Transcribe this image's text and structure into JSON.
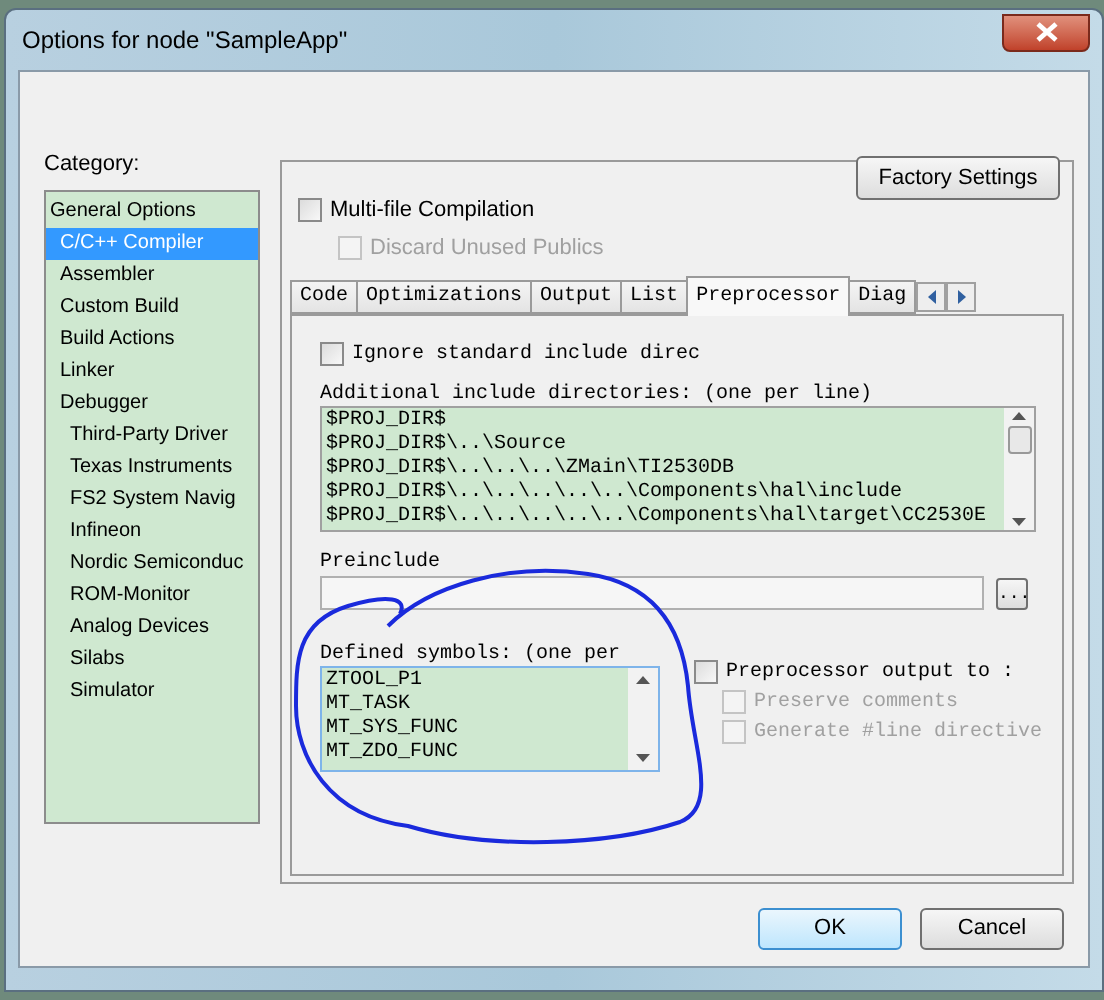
{
  "window": {
    "title": "Options for node \"SampleApp\""
  },
  "category_label": "Category:",
  "categories": [
    {
      "label": "General Options",
      "selected": false,
      "children": [
        {
          "label": "C/C++ Compiler",
          "selected": true
        },
        {
          "label": "Assembler",
          "selected": false
        },
        {
          "label": "Custom Build",
          "selected": false
        },
        {
          "label": "Build Actions",
          "selected": false
        },
        {
          "label": "Linker",
          "selected": false
        },
        {
          "label": "Debugger",
          "selected": false,
          "children": [
            {
              "label": "Third-Party Driver",
              "selected": false
            },
            {
              "label": "Texas Instruments",
              "selected": false
            },
            {
              "label": "FS2 System Navig",
              "selected": false
            },
            {
              "label": "Infineon",
              "selected": false
            },
            {
              "label": "Nordic Semiconduc",
              "selected": false
            },
            {
              "label": "ROM-Monitor",
              "selected": false
            },
            {
              "label": "Analog Devices",
              "selected": false
            },
            {
              "label": "Silabs",
              "selected": false
            },
            {
              "label": "Simulator",
              "selected": false
            }
          ]
        }
      ]
    }
  ],
  "factory_settings_button": "Factory Settings",
  "options": [
    {
      "label": "Multi-file Compilation",
      "checked": false,
      "disabled": false,
      "indent": false
    },
    {
      "label": "Discard Unused Publics",
      "checked": false,
      "disabled": true,
      "indent": true
    }
  ],
  "tabs": [
    {
      "label": "Code",
      "selected": false
    },
    {
      "label": "Optimizations",
      "selected": false
    },
    {
      "label": "Output",
      "selected": false
    },
    {
      "label": "List",
      "selected": false
    },
    {
      "label": "Preprocessor",
      "selected": true
    },
    {
      "label": "Diag",
      "selected": false
    }
  ],
  "ignore_standard": {
    "label": "Ignore standard include direc",
    "checked": false
  },
  "include_dirs": {
    "label": "Additional include directories: (one per line)",
    "lines": [
      "$PROJ_DIR$",
      "$PROJ_DIR$\\..\\Source",
      "$PROJ_DIR$\\..\\..\\..\\ZMain\\TI2530DB",
      "$PROJ_DIR$\\..\\..\\..\\..\\..\\Components\\hal\\include",
      "$PROJ_DIR$\\..\\..\\..\\..\\..\\Components\\hal\\target\\CC2530E"
    ]
  },
  "preinclude": {
    "label": "Preinclude",
    "browse_button": "..."
  },
  "defined_symbols": {
    "label": "Defined symbols: (one per",
    "lines": [
      "ZTOOL_P1",
      "MT_TASK",
      "MT_SYS_FUNC",
      "MT_ZDO_FUNC"
    ]
  },
  "output_options": [
    {
      "label": "Preprocessor output to :",
      "checked": false,
      "disabled": false
    },
    {
      "label": "Preserve comments",
      "checked": false,
      "disabled": true
    },
    {
      "label": "Generate #line directive",
      "checked": false,
      "disabled": true
    }
  ],
  "buttons": [
    {
      "label": "OK",
      "default": true
    },
    {
      "label": "Cancel",
      "default": false
    }
  ]
}
